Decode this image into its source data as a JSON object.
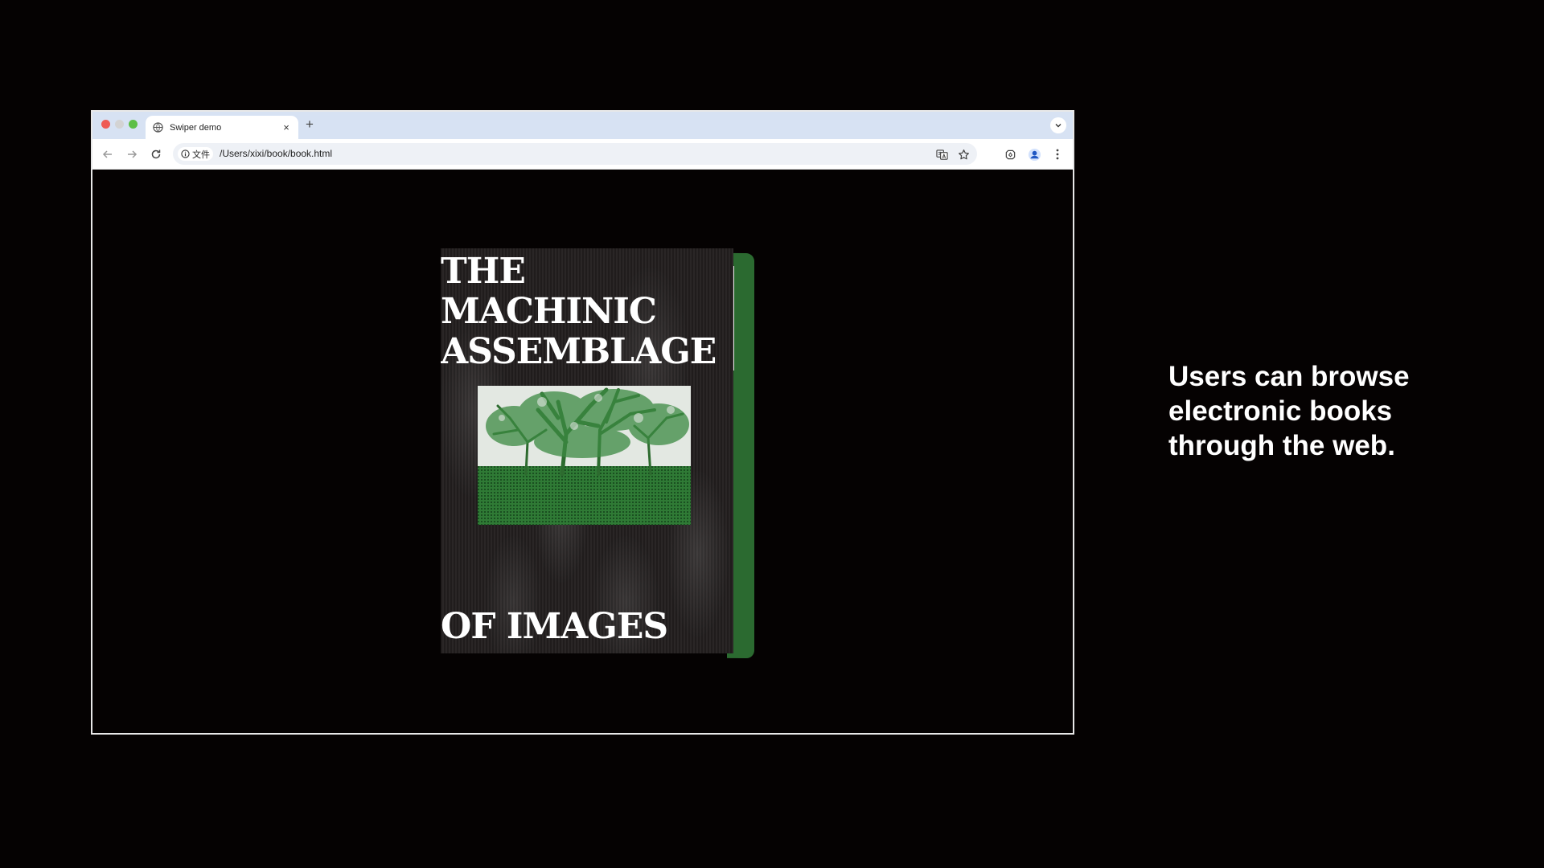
{
  "browser": {
    "tab": {
      "title": "Swiper demo",
      "icon": "globe-icon",
      "close_glyph": "×"
    },
    "new_tab_glyph": "+",
    "omnibox": {
      "info_label": "文件",
      "url": "/Users/xixi/book/book.html"
    }
  },
  "book": {
    "title": "THE MACHINIC\nASSEMBLAGE",
    "subtitle": "OF IMAGES",
    "page_colors": [
      "#2b6a30",
      "#c86f9d",
      "#f4f4f4",
      "#e9e9e9"
    ]
  },
  "caption": "Users can browse electronic books through the web."
}
